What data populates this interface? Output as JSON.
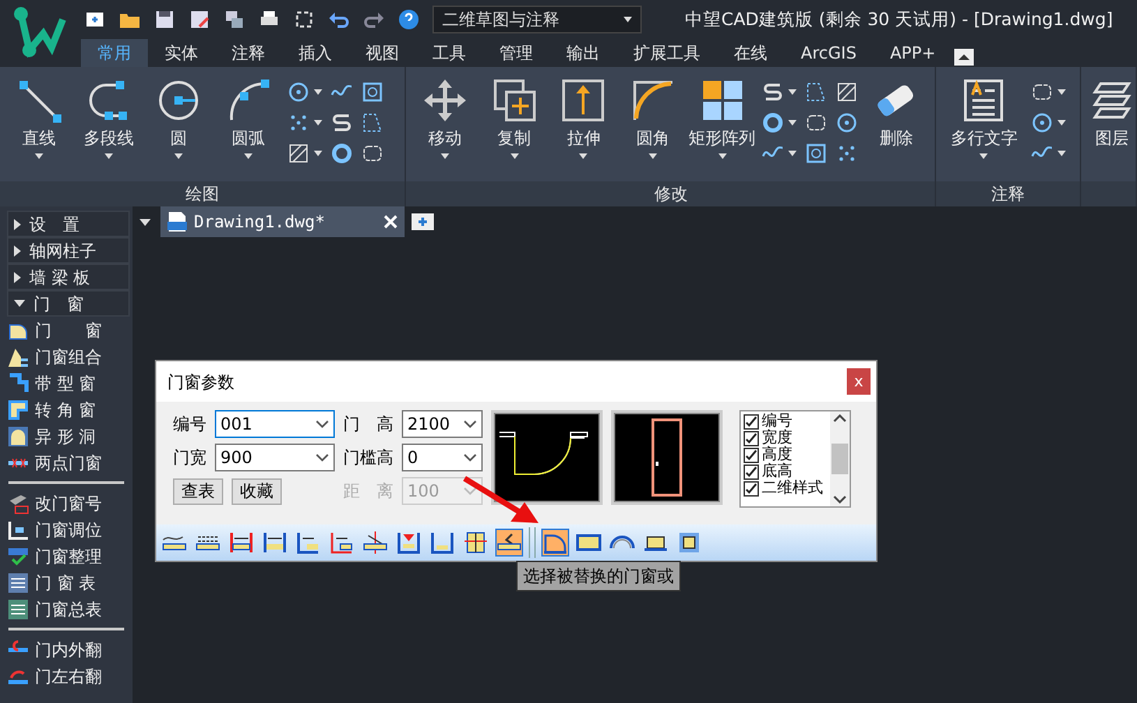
{
  "title_bar": {
    "workspace": "二维草图与注释",
    "title": "中望CAD建筑版 (剩余 30 天试用) - [Drawing1.dwg]"
  },
  "ribbon_tabs": [
    {
      "label": "常用",
      "selected": true
    },
    {
      "label": "实体",
      "selected": false
    },
    {
      "label": "注释",
      "selected": false
    },
    {
      "label": "插入",
      "selected": false
    },
    {
      "label": "视图",
      "selected": false
    },
    {
      "label": "工具",
      "selected": false
    },
    {
      "label": "管理",
      "selected": false
    },
    {
      "label": "输出",
      "selected": false
    },
    {
      "label": "扩展工具",
      "selected": false
    },
    {
      "label": "在线",
      "selected": false
    },
    {
      "label": "ArcGIS",
      "selected": false
    },
    {
      "label": "APP+",
      "selected": false
    }
  ],
  "ribbon_groups": [
    {
      "label": "绘图",
      "tools": [
        "直线",
        "多段线",
        "圆",
        "圆弧"
      ]
    },
    {
      "label": "修改",
      "tools": [
        "移动",
        "复制",
        "拉伸",
        "圆角",
        "矩形阵列",
        "删除"
      ]
    },
    {
      "label": "注释",
      "tools": [
        "多行文字"
      ]
    },
    {
      "tools": [
        "图层"
      ]
    }
  ],
  "doc_tabs": [
    {
      "label": "Drawing1.dwg*",
      "selected": true
    }
  ],
  "sidebar": {
    "sections": [
      {
        "label": "设　置",
        "expanded": false
      },
      {
        "label": "轴网柱子",
        "expanded": false
      },
      {
        "label": "墙 梁 板",
        "expanded": false
      },
      {
        "label": "门　窗",
        "expanded": true,
        "groups": [
          [
            "门　　窗",
            "门窗组合",
            "带 型 窗",
            "转 角 窗",
            "异 形 洞",
            "两点门窗"
          ],
          [
            "改门窗号",
            "门窗调位",
            "门窗整理",
            "门 窗 表",
            "门窗总表"
          ],
          [
            "门内外翻",
            "门左右翻"
          ]
        ]
      }
    ]
  },
  "dialog": {
    "title": "门窗参数",
    "close": "x",
    "fields": [
      {
        "label": "编号",
        "value": "001",
        "disabled": false
      },
      {
        "label": "门　高",
        "value": "2100",
        "disabled": false
      },
      {
        "label": "门宽",
        "value": "900",
        "disabled": false
      },
      {
        "label": "门槛高",
        "value": "0",
        "disabled": false
      },
      {
        "label": "距　离",
        "value": "100",
        "disabled": true
      }
    ],
    "buttons": [
      "查表",
      "收藏"
    ],
    "checklist": [
      {
        "label": "编号",
        "checked": true
      },
      {
        "label": "宽度",
        "checked": true
      },
      {
        "label": "高度",
        "checked": true
      },
      {
        "label": "底高",
        "checked": true
      },
      {
        "label": "二维样式",
        "checked": true
      }
    ],
    "toolbar": [
      [
        {
          "selected": false
        },
        {
          "selected": false
        },
        {
          "selected": false
        },
        {
          "selected": false
        },
        {
          "selected": false
        },
        {
          "selected": false
        },
        {
          "selected": false
        },
        {
          "selected": false
        },
        {
          "selected": false
        },
        {
          "selected": false
        },
        {
          "selected": true
        }
      ],
      [
        {
          "selected": true
        },
        {
          "selected": false
        },
        {
          "selected": false
        },
        {
          "selected": false
        },
        {
          "selected": false
        }
      ]
    ]
  },
  "tooltip": "选择被替换的门窗或"
}
